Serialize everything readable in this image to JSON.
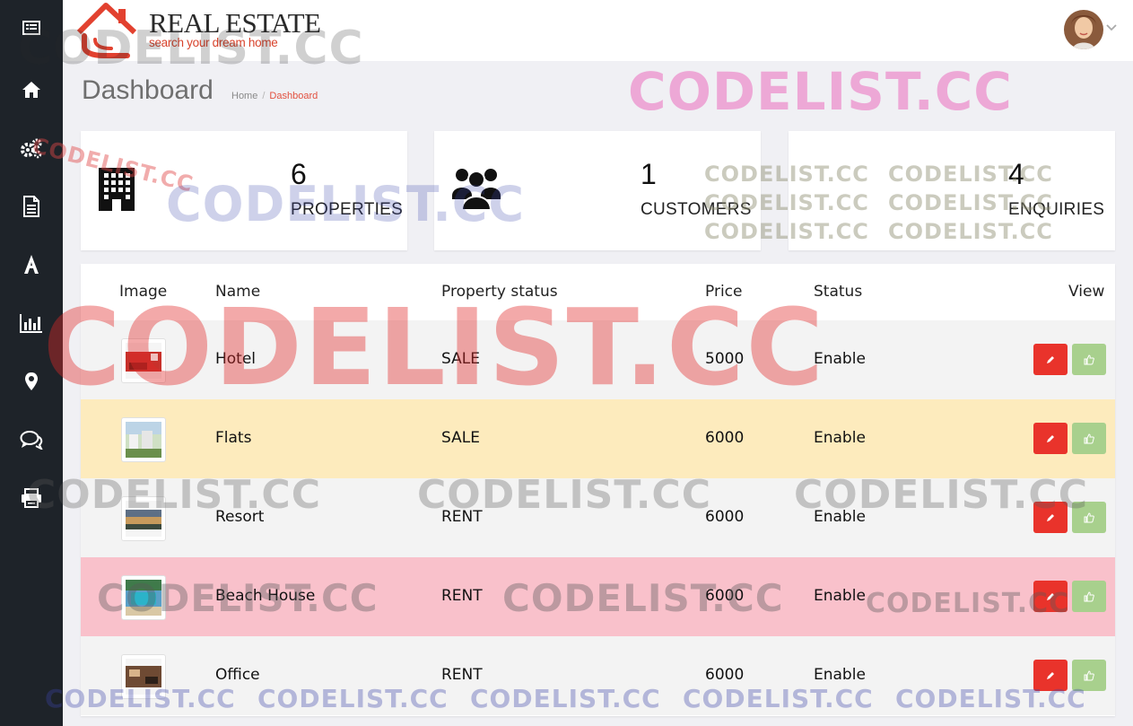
{
  "brand": {
    "title": "REAL ESTATE",
    "tagline": "search your dream home"
  },
  "sidebar": {
    "items": [
      {
        "icon": "menu-toggle-icon"
      },
      {
        "icon": "home-icon"
      },
      {
        "icon": "settings-icon"
      },
      {
        "icon": "document-icon"
      },
      {
        "icon": "font-icon"
      },
      {
        "icon": "bar-chart-icon"
      },
      {
        "icon": "map-marker-icon"
      },
      {
        "icon": "comments-icon"
      },
      {
        "icon": "print-icon"
      }
    ]
  },
  "page": {
    "title": "Dashboard",
    "breadcrumb": [
      "Home",
      "Dashboard"
    ]
  },
  "stats": [
    {
      "value": "6",
      "label": "PROPERTIES",
      "icon": "building-icon"
    },
    {
      "value": "1",
      "label": "CUSTOMERS",
      "icon": "users-icon"
    },
    {
      "value": "4",
      "label": "ENQUIRIES",
      "icon": "enquiry-icon"
    }
  ],
  "table": {
    "headers": [
      "Image",
      "Name",
      "Property status",
      "Price",
      "Status",
      "View"
    ],
    "rows": [
      {
        "name": "Hotel",
        "property_status": "SALE",
        "price": "5000",
        "status": "Enable",
        "row_color": "#f3f3f3"
      },
      {
        "name": "Flats",
        "property_status": "SALE",
        "price": "6000",
        "status": "Enable",
        "row_color": "#fdebbd"
      },
      {
        "name": "Resort",
        "property_status": "RENT",
        "price": "6000",
        "status": "Enable",
        "row_color": "#f3f3f3"
      },
      {
        "name": "Beach House",
        "property_status": "RENT",
        "price": "6000",
        "status": "Enable",
        "row_color": "#f9c1cb"
      },
      {
        "name": "Office",
        "property_status": "RENT",
        "price": "6000",
        "status": "Enable",
        "row_color": "#f3f3f3"
      }
    ]
  },
  "colors": {
    "sidebar_bg": "#1e2329",
    "accent_red": "#e9332b",
    "like_green": "#a8d08d",
    "breadcrumb_active": "#e2513f"
  },
  "watermark": "CODELIST.CC"
}
